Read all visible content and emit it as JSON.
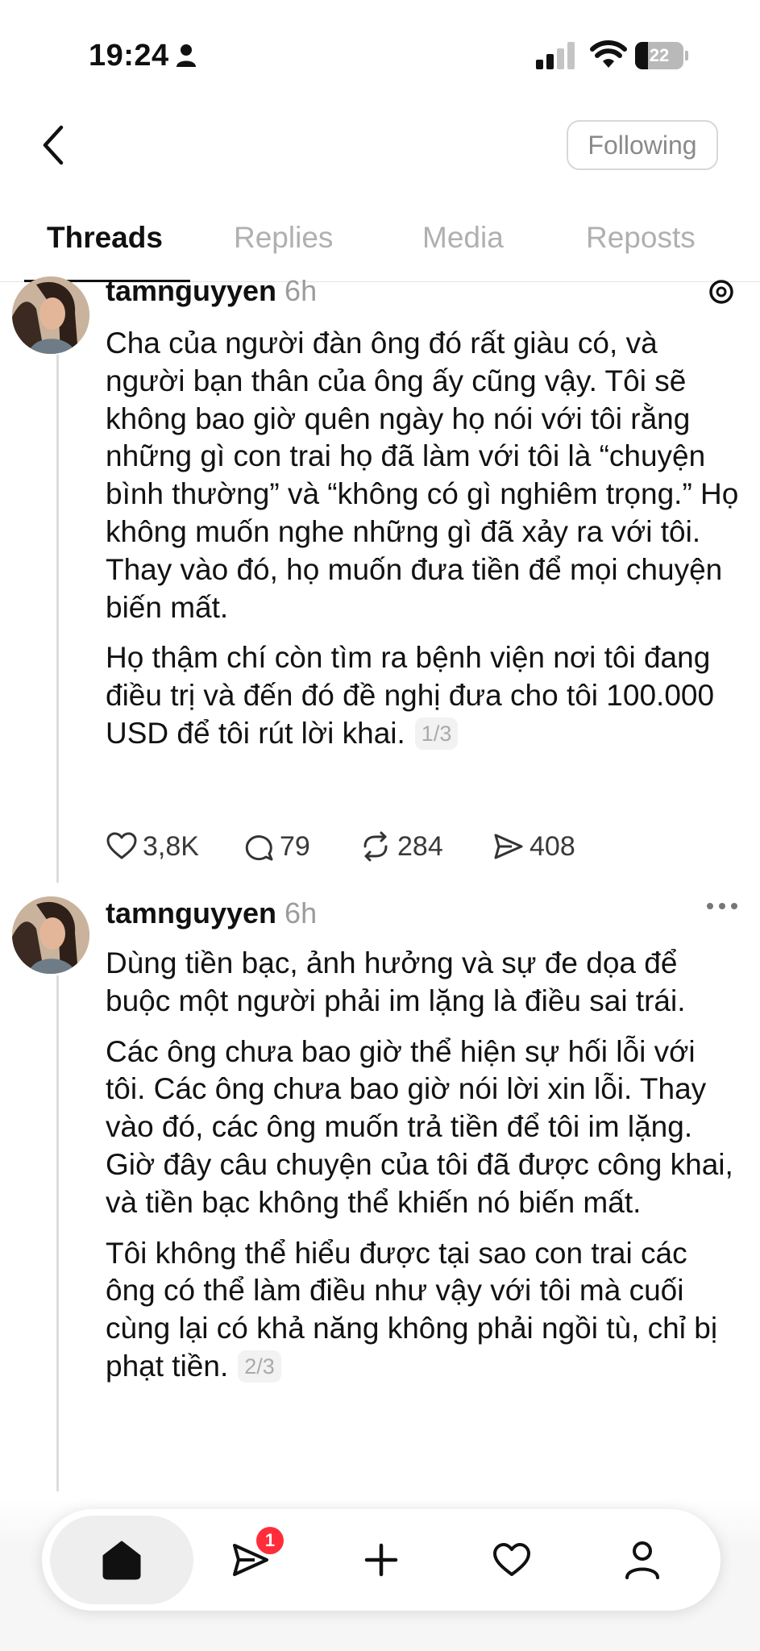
{
  "status_bar": {
    "time": "19:24",
    "battery": "22"
  },
  "header": {
    "following_label": "Following"
  },
  "tabs": [
    {
      "label": "Threads",
      "active": true
    },
    {
      "label": "Replies",
      "active": false
    },
    {
      "label": "Media",
      "active": false
    },
    {
      "label": "Reposts",
      "active": false
    }
  ],
  "posts": [
    {
      "username": "tamnguyyen",
      "time": "6h",
      "paragraphs": [
        "Cha của người đàn ông đó rất giàu có, và người bạn thân của ông ấy cũng vậy. Tôi sẽ không bao giờ quên ngày họ nói với tôi rằng những gì con trai họ đã làm với tôi là “chuyện bình thường” và “không có gì nghiêm trọng.” Họ không muốn nghe những gì đã xảy ra với tôi. Thay vào đó, họ muốn đưa tiền để mọi chuyện biến mất.",
        "Họ thậm chí còn tìm ra bệnh viện nơi tôi đang điều trị và đến đó đề nghị đưa cho tôi 100.000 USD để tôi rút lời khai."
      ],
      "pager": "1/3",
      "likes": "3,8K",
      "comments": "79",
      "reposts": "284",
      "shares": "408"
    },
    {
      "username": "tamnguyyen",
      "time": "6h",
      "paragraphs": [
        "Dùng tiền bạc, ảnh hưởng và sự đe dọa để buộc một người phải im lặng là điều sai trái.",
        "Các ông chưa bao giờ thể hiện sự hối lỗi với tôi. Các ông chưa bao giờ nói lời xin lỗi. Thay vào đó, các ông muốn trả tiền để tôi im lặng. Giờ đây câu chuyện của tôi đã được công khai, và tiền bạc không thể khiến nó biến mất.",
        "Tôi không thể hiểu được tại sao con trai các ông có thể làm điều như vậy với tôi mà cuối cùng lại có khả năng không phải ngồi tù, chỉ bị phạt tiền."
      ],
      "pager": "2/3"
    }
  ],
  "nav": {
    "messages_badge": "1"
  },
  "icons": [
    "person-icon",
    "signal-icon",
    "wifi-icon",
    "back-chevron-icon",
    "threads-logo-icon",
    "heart-icon",
    "comment-icon",
    "repost-icon",
    "share-icon",
    "more-icon",
    "home-icon",
    "send-icon",
    "plus-icon",
    "profile-icon"
  ]
}
